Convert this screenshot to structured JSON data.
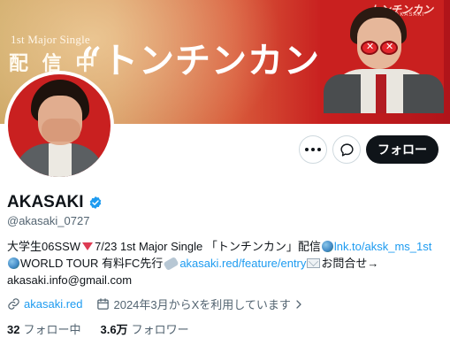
{
  "banner": {
    "small_text": "1st Major Single",
    "status_text": "配 信 中",
    "title": "“トンチンカン”",
    "album_text": "トンチンカン",
    "album_sub": "AKASAKI"
  },
  "actions": {
    "follow_label": "フォロー"
  },
  "profile": {
    "display_name": "AKASAKI",
    "handle": "@akasaki_0727",
    "bio": {
      "line1_text": "大学生06SSW",
      "line1_release": "7/23 1st Major Single 「トンチンカン」配信",
      "line1_link": "lnk.to/aksk_ms_1st",
      "line2_text": "WORLD TOUR 有料FC先行",
      "line2_link": "akasaki.red/feature/entry",
      "line2_tail": "お問合せ→",
      "line3_text": "akasaki.info@gmail.com"
    },
    "website": "akasaki.red",
    "joined": "2024年3月からXを利用しています",
    "following_count": "32",
    "following_label": "フォロー中",
    "followers_count": "3.6万",
    "followers_label": "フォロワー"
  },
  "colors": {
    "link": "#1d9bf0",
    "verified": "#1d9bf0",
    "follow_button": "#0f1419"
  }
}
